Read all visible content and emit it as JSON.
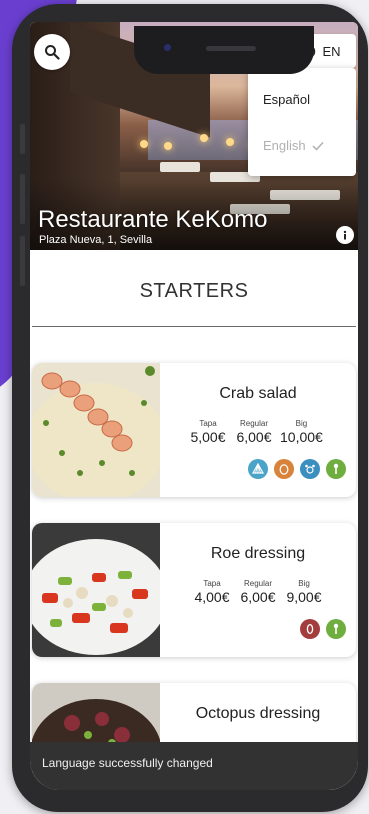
{
  "header": {
    "restaurant_name": "Restaurante KeKomo",
    "address": "Plaza Nueva, 1, Sevilla",
    "language_button": "EN"
  },
  "language_menu": {
    "options": [
      {
        "label": "Español",
        "selected": false
      },
      {
        "label": "English",
        "selected": true
      }
    ]
  },
  "section": {
    "title": "STARTERS"
  },
  "dishes": [
    {
      "name": "Crab salad",
      "prices": [
        {
          "size": "Tapa",
          "price": "5,00€"
        },
        {
          "size": "Regular",
          "price": "6,00€"
        },
        {
          "size": "Big",
          "price": "10,00€"
        }
      ],
      "allergens": [
        {
          "icon": "shellfish-icon",
          "color": "#4aa3c9"
        },
        {
          "icon": "egg-icon",
          "color": "#d9823a"
        },
        {
          "icon": "crustacean-icon",
          "color": "#3a8fc0"
        },
        {
          "icon": "celery-icon",
          "color": "#6fad3e"
        }
      ]
    },
    {
      "name": "Roe dressing",
      "prices": [
        {
          "size": "Tapa",
          "price": "4,00€"
        },
        {
          "size": "Regular",
          "price": "6,00€"
        },
        {
          "size": "Big",
          "price": "9,00€"
        }
      ],
      "allergens": [
        {
          "icon": "fish-icon",
          "color": "#a33d3d"
        },
        {
          "icon": "celery-icon",
          "color": "#6fad3e"
        }
      ]
    },
    {
      "name": "Octopus dressing",
      "prices": [],
      "allergens": []
    }
  ],
  "snackbar": {
    "message": "Language successfully changed"
  }
}
